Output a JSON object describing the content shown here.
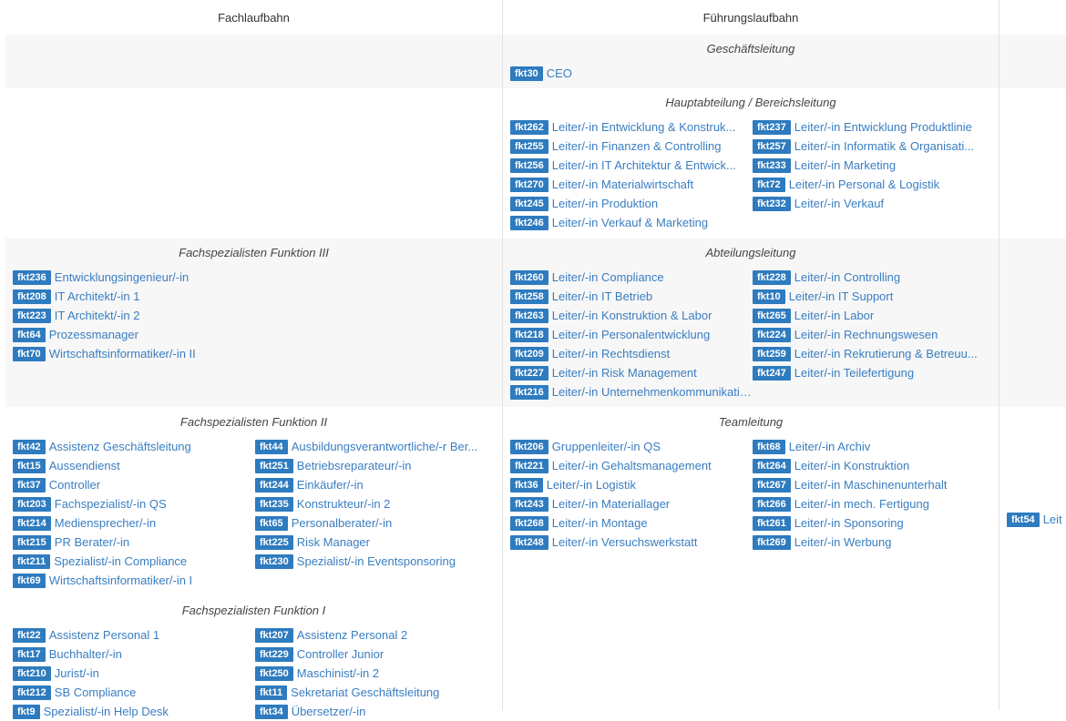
{
  "columns": {
    "fach": "Fachlaufbahn",
    "fuehrung": "Führungslaufbahn"
  },
  "fuehrung_sections": [
    {
      "title": "Geschäftsleitung",
      "items": [
        {
          "code": "fkt30",
          "label": "CEO"
        }
      ]
    },
    {
      "title": "Hauptabteilung / Bereichsleitung",
      "items": [
        {
          "code": "fkt262",
          "label": "Leiter/-in Entwicklung & Konstruk..."
        },
        {
          "code": "fkt237",
          "label": "Leiter/-in Entwicklung Produktlinie"
        },
        {
          "code": "fkt255",
          "label": "Leiter/-in Finanzen & Controlling"
        },
        {
          "code": "fkt257",
          "label": "Leiter/-in Informatik & Organisati..."
        },
        {
          "code": "fkt256",
          "label": "Leiter/-in IT Architektur & Entwick..."
        },
        {
          "code": "fkt233",
          "label": "Leiter/-in Marketing"
        },
        {
          "code": "fkt270",
          "label": "Leiter/-in Materialwirtschaft"
        },
        {
          "code": "fkt72",
          "label": "Leiter/-in Personal & Logistik"
        },
        {
          "code": "fkt245",
          "label": "Leiter/-in Produktion"
        },
        {
          "code": "fkt232",
          "label": "Leiter/-in Verkauf"
        },
        {
          "code": "fkt246",
          "label": "Leiter/-in Verkauf & Marketing"
        }
      ]
    },
    {
      "title": "Abteilungsleitung",
      "items": [
        {
          "code": "fkt260",
          "label": "Leiter/-in Compliance"
        },
        {
          "code": "fkt228",
          "label": "Leiter/-in Controlling"
        },
        {
          "code": "fkt258",
          "label": "Leiter/-in IT Betrieb"
        },
        {
          "code": "fkt10",
          "label": "Leiter/-in IT Support"
        },
        {
          "code": "fkt263",
          "label": "Leiter/-in Konstruktion & Labor"
        },
        {
          "code": "fkt265",
          "label": "Leiter/-in Labor"
        },
        {
          "code": "fkt218",
          "label": "Leiter/-in Personalentwicklung"
        },
        {
          "code": "fkt224",
          "label": "Leiter/-in Rechnungswesen"
        },
        {
          "code": "fkt209",
          "label": "Leiter/-in Rechtsdienst"
        },
        {
          "code": "fkt259",
          "label": "Leiter/-in Rekrutierung & Betreuu..."
        },
        {
          "code": "fkt227",
          "label": "Leiter/-in Risk Management"
        },
        {
          "code": "fkt247",
          "label": "Leiter/-in Teilefertigung"
        },
        {
          "code": "fkt216",
          "label": "Leiter/-in Unternehmenkommunikation"
        }
      ]
    },
    {
      "title": "Teamleitung",
      "items": [
        {
          "code": "fkt206",
          "label": "Gruppenleiter/-in QS"
        },
        {
          "code": "fkt68",
          "label": "Leiter/-in Archiv"
        },
        {
          "code": "fkt221",
          "label": "Leiter/-in Gehaltsmanagement"
        },
        {
          "code": "fkt264",
          "label": "Leiter/-in Konstruktion"
        },
        {
          "code": "fkt36",
          "label": "Leiter/-in Logistik"
        },
        {
          "code": "fkt267",
          "label": "Leiter/-in Maschinenunterhalt"
        },
        {
          "code": "fkt243",
          "label": "Leiter/-in Materiallager"
        },
        {
          "code": "fkt266",
          "label": "Leiter/-in mech. Fertigung"
        },
        {
          "code": "fkt268",
          "label": "Leiter/-in Montage"
        },
        {
          "code": "fkt261",
          "label": "Leiter/-in Sponsoring"
        },
        {
          "code": "fkt248",
          "label": "Leiter/-in Versuchswerkstatt"
        },
        {
          "code": "fkt269",
          "label": "Leiter/-in Werbung"
        }
      ]
    }
  ],
  "fach_sections": [
    {
      "title": "Fachspezialisten Funktion III",
      "items": [
        {
          "code": "fkt236",
          "label": "Entwicklungsingenieur/-in"
        },
        {
          "code": "fkt208",
          "label": "IT Architekt/-in 1"
        },
        {
          "code": "fkt223",
          "label": "IT Architekt/-in 2"
        },
        {
          "code": "fkt64",
          "label": "Prozessmanager"
        },
        {
          "code": "fkt70",
          "label": "Wirtschaftsinformatiker/-in II"
        }
      ]
    },
    {
      "title": "Fachspezialisten Funktion II",
      "items": [
        {
          "code": "fkt42",
          "label": "Assistenz Geschäftsleitung"
        },
        {
          "code": "fkt44",
          "label": "Ausbildungsverantwortliche/-r Ber..."
        },
        {
          "code": "fkt15",
          "label": "Aussendienst"
        },
        {
          "code": "fkt251",
          "label": "Betriebsreparateur/-in"
        },
        {
          "code": "fkt37",
          "label": "Controller"
        },
        {
          "code": "fkt244",
          "label": "Einkäufer/-in"
        },
        {
          "code": "fkt203",
          "label": "Fachspezialist/-in QS"
        },
        {
          "code": "fkt235",
          "label": "Konstrukteur/-in 2"
        },
        {
          "code": "fkt214",
          "label": "Mediensprecher/-in"
        },
        {
          "code": "fkt65",
          "label": "Personalberater/-in"
        },
        {
          "code": "fkt215",
          "label": "PR Berater/-in"
        },
        {
          "code": "fkt225",
          "label": "Risk Manager"
        },
        {
          "code": "fkt211",
          "label": "Spezialist/-in Compliance"
        },
        {
          "code": "fkt230",
          "label": "Spezialist/-in Eventsponsoring"
        },
        {
          "code": "fkt69",
          "label": "Wirtschaftsinformatiker/-in I"
        }
      ]
    },
    {
      "title": "Fachspezialisten Funktion I",
      "items": [
        {
          "code": "fkt22",
          "label": "Assistenz Personal 1"
        },
        {
          "code": "fkt207",
          "label": "Assistenz Personal 2"
        },
        {
          "code": "fkt17",
          "label": "Buchhalter/-in"
        },
        {
          "code": "fkt229",
          "label": "Controller Junior"
        },
        {
          "code": "fkt210",
          "label": "Jurist/-in"
        },
        {
          "code": "fkt250",
          "label": "Maschinist/-in 2"
        },
        {
          "code": "fkt212",
          "label": "SB Compliance"
        },
        {
          "code": "fkt11",
          "label": "Sekretariat Geschäftsleitung"
        },
        {
          "code": "fkt9",
          "label": "Spezialist/-in Help Desk"
        },
        {
          "code": "fkt34",
          "label": "Übersetzer/-in"
        }
      ]
    }
  ],
  "third_column": {
    "items": [
      {
        "code": "fkt54",
        "label": "Leit"
      }
    ]
  },
  "colors": {
    "badge": "#2e7bbf",
    "link": "#3a7ec1",
    "band": "#f7f7f7"
  }
}
